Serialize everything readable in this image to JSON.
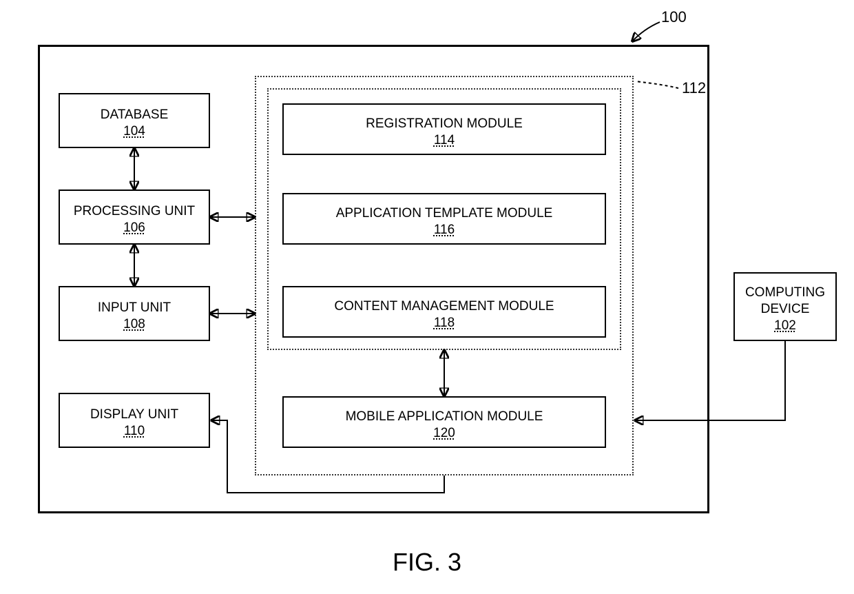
{
  "figure": {
    "caption": "FIG. 3",
    "system_ref": "100",
    "group_ref": "112"
  },
  "blocks": {
    "database": {
      "label": "DATABASE",
      "ref": "104"
    },
    "processing": {
      "label": "PROCESSING UNIT",
      "ref": "106"
    },
    "input": {
      "label": "INPUT UNIT",
      "ref": "108"
    },
    "display": {
      "label": "DISPLAY UNIT",
      "ref": "110"
    },
    "registration": {
      "label": "REGISTRATION MODULE",
      "ref": "114"
    },
    "template": {
      "label": "APPLICATION TEMPLATE MODULE",
      "ref": "116"
    },
    "content": {
      "label": "CONTENT MANAGEMENT MODULE",
      "ref": "118"
    },
    "mobile": {
      "label": "MOBILE APPLICATION MODULE",
      "ref": "120"
    },
    "computing": {
      "label": "COMPUTING DEVICE",
      "ref": "102"
    }
  }
}
